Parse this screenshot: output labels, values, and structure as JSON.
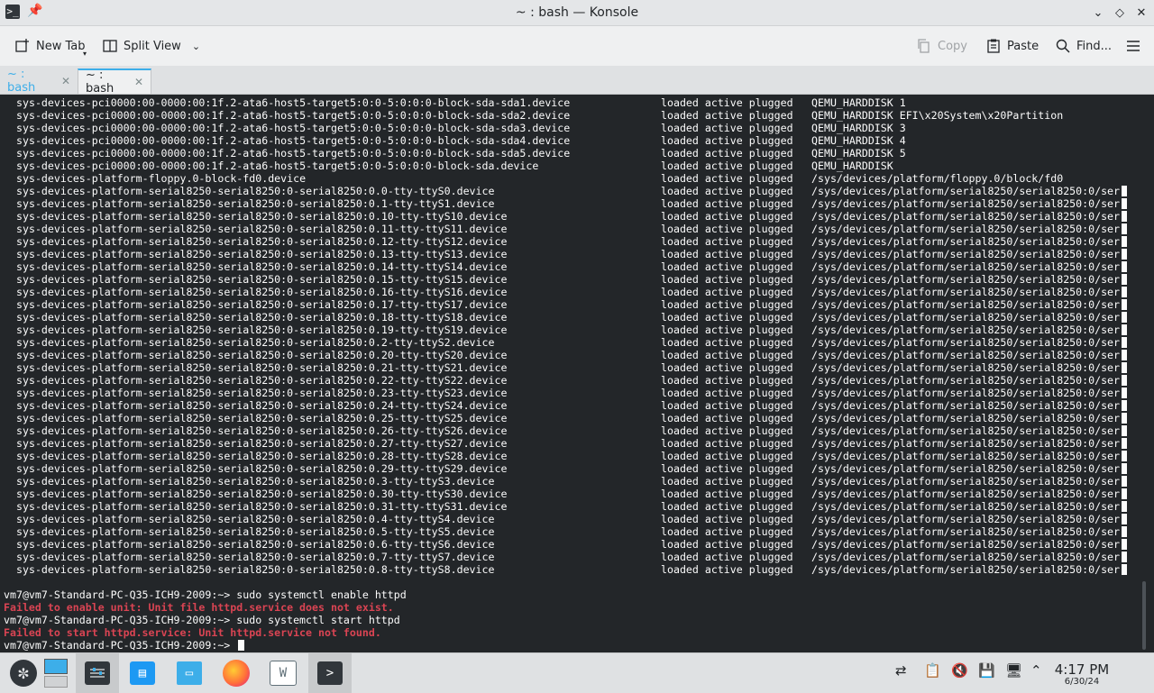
{
  "window": {
    "title": "~ : bash — Konsole",
    "app_icon": "terminal-icon",
    "controls": [
      "minimize",
      "maximize",
      "close"
    ]
  },
  "toolbar": {
    "new_tab": "New Tab",
    "split_view": "Split View",
    "copy": "Copy",
    "paste": "Paste",
    "find": "Find...",
    "menu_icon": "hamburger-menu-icon"
  },
  "tabs": [
    {
      "label": "~ : bash",
      "active": false
    },
    {
      "label": "~ : bash",
      "active": true
    }
  ],
  "terminal": {
    "rows": [
      {
        "unit": "sys-devices-pci0000:00-0000:00:1f.2-ata6-host5-target5:0:0-5:0:0:0-block-sda-sda1.device",
        "state": "loaded active plugged",
        "desc": "QEMU_HARDDISK 1",
        "truncated": false
      },
      {
        "unit": "sys-devices-pci0000:00-0000:00:1f.2-ata6-host5-target5:0:0-5:0:0:0-block-sda-sda2.device",
        "state": "loaded active plugged",
        "desc": "QEMU_HARDDISK EFI\\x20System\\x20Partition",
        "truncated": false
      },
      {
        "unit": "sys-devices-pci0000:00-0000:00:1f.2-ata6-host5-target5:0:0-5:0:0:0-block-sda-sda3.device",
        "state": "loaded active plugged",
        "desc": "QEMU_HARDDISK 3",
        "truncated": false
      },
      {
        "unit": "sys-devices-pci0000:00-0000:00:1f.2-ata6-host5-target5:0:0-5:0:0:0-block-sda-sda4.device",
        "state": "loaded active plugged",
        "desc": "QEMU_HARDDISK 4",
        "truncated": false
      },
      {
        "unit": "sys-devices-pci0000:00-0000:00:1f.2-ata6-host5-target5:0:0-5:0:0:0-block-sda-sda5.device",
        "state": "loaded active plugged",
        "desc": "QEMU_HARDDISK 5",
        "truncated": false
      },
      {
        "unit": "sys-devices-pci0000:00-0000:00:1f.2-ata6-host5-target5:0:0-5:0:0:0-block-sda.device",
        "state": "loaded active plugged",
        "desc": "QEMU_HARDDISK",
        "truncated": false
      },
      {
        "unit": "sys-devices-platform-floppy.0-block-fd0.device",
        "state": "loaded active plugged",
        "desc": "/sys/devices/platform/floppy.0/block/fd0",
        "truncated": false
      },
      {
        "unit": "sys-devices-platform-serial8250-serial8250:0-serial8250:0.0-tty-ttyS0.device",
        "state": "loaded active plugged",
        "desc": "/sys/devices/platform/serial8250/serial8250:0/ser",
        "truncated": true
      },
      {
        "unit": "sys-devices-platform-serial8250-serial8250:0-serial8250:0.1-tty-ttyS1.device",
        "state": "loaded active plugged",
        "desc": "/sys/devices/platform/serial8250/serial8250:0/ser",
        "truncated": true
      },
      {
        "unit": "sys-devices-platform-serial8250-serial8250:0-serial8250:0.10-tty-ttyS10.device",
        "state": "loaded active plugged",
        "desc": "/sys/devices/platform/serial8250/serial8250:0/ser",
        "truncated": true
      },
      {
        "unit": "sys-devices-platform-serial8250-serial8250:0-serial8250:0.11-tty-ttyS11.device",
        "state": "loaded active plugged",
        "desc": "/sys/devices/platform/serial8250/serial8250:0/ser",
        "truncated": true
      },
      {
        "unit": "sys-devices-platform-serial8250-serial8250:0-serial8250:0.12-tty-ttyS12.device",
        "state": "loaded active plugged",
        "desc": "/sys/devices/platform/serial8250/serial8250:0/ser",
        "truncated": true
      },
      {
        "unit": "sys-devices-platform-serial8250-serial8250:0-serial8250:0.13-tty-ttyS13.device",
        "state": "loaded active plugged",
        "desc": "/sys/devices/platform/serial8250/serial8250:0/ser",
        "truncated": true
      },
      {
        "unit": "sys-devices-platform-serial8250-serial8250:0-serial8250:0.14-tty-ttyS14.device",
        "state": "loaded active plugged",
        "desc": "/sys/devices/platform/serial8250/serial8250:0/ser",
        "truncated": true
      },
      {
        "unit": "sys-devices-platform-serial8250-serial8250:0-serial8250:0.15-tty-ttyS15.device",
        "state": "loaded active plugged",
        "desc": "/sys/devices/platform/serial8250/serial8250:0/ser",
        "truncated": true
      },
      {
        "unit": "sys-devices-platform-serial8250-serial8250:0-serial8250:0.16-tty-ttyS16.device",
        "state": "loaded active plugged",
        "desc": "/sys/devices/platform/serial8250/serial8250:0/ser",
        "truncated": true
      },
      {
        "unit": "sys-devices-platform-serial8250-serial8250:0-serial8250:0.17-tty-ttyS17.device",
        "state": "loaded active plugged",
        "desc": "/sys/devices/platform/serial8250/serial8250:0/ser",
        "truncated": true
      },
      {
        "unit": "sys-devices-platform-serial8250-serial8250:0-serial8250:0.18-tty-ttyS18.device",
        "state": "loaded active plugged",
        "desc": "/sys/devices/platform/serial8250/serial8250:0/ser",
        "truncated": true
      },
      {
        "unit": "sys-devices-platform-serial8250-serial8250:0-serial8250:0.19-tty-ttyS19.device",
        "state": "loaded active plugged",
        "desc": "/sys/devices/platform/serial8250/serial8250:0/ser",
        "truncated": true
      },
      {
        "unit": "sys-devices-platform-serial8250-serial8250:0-serial8250:0.2-tty-ttyS2.device",
        "state": "loaded active plugged",
        "desc": "/sys/devices/platform/serial8250/serial8250:0/ser",
        "truncated": true
      },
      {
        "unit": "sys-devices-platform-serial8250-serial8250:0-serial8250:0.20-tty-ttyS20.device",
        "state": "loaded active plugged",
        "desc": "/sys/devices/platform/serial8250/serial8250:0/ser",
        "truncated": true
      },
      {
        "unit": "sys-devices-platform-serial8250-serial8250:0-serial8250:0.21-tty-ttyS21.device",
        "state": "loaded active plugged",
        "desc": "/sys/devices/platform/serial8250/serial8250:0/ser",
        "truncated": true
      },
      {
        "unit": "sys-devices-platform-serial8250-serial8250:0-serial8250:0.22-tty-ttyS22.device",
        "state": "loaded active plugged",
        "desc": "/sys/devices/platform/serial8250/serial8250:0/ser",
        "truncated": true
      },
      {
        "unit": "sys-devices-platform-serial8250-serial8250:0-serial8250:0.23-tty-ttyS23.device",
        "state": "loaded active plugged",
        "desc": "/sys/devices/platform/serial8250/serial8250:0/ser",
        "truncated": true
      },
      {
        "unit": "sys-devices-platform-serial8250-serial8250:0-serial8250:0.24-tty-ttyS24.device",
        "state": "loaded active plugged",
        "desc": "/sys/devices/platform/serial8250/serial8250:0/ser",
        "truncated": true
      },
      {
        "unit": "sys-devices-platform-serial8250-serial8250:0-serial8250:0.25-tty-ttyS25.device",
        "state": "loaded active plugged",
        "desc": "/sys/devices/platform/serial8250/serial8250:0/ser",
        "truncated": true
      },
      {
        "unit": "sys-devices-platform-serial8250-serial8250:0-serial8250:0.26-tty-ttyS26.device",
        "state": "loaded active plugged",
        "desc": "/sys/devices/platform/serial8250/serial8250:0/ser",
        "truncated": true
      },
      {
        "unit": "sys-devices-platform-serial8250-serial8250:0-serial8250:0.27-tty-ttyS27.device",
        "state": "loaded active plugged",
        "desc": "/sys/devices/platform/serial8250/serial8250:0/ser",
        "truncated": true
      },
      {
        "unit": "sys-devices-platform-serial8250-serial8250:0-serial8250:0.28-tty-ttyS28.device",
        "state": "loaded active plugged",
        "desc": "/sys/devices/platform/serial8250/serial8250:0/ser",
        "truncated": true
      },
      {
        "unit": "sys-devices-platform-serial8250-serial8250:0-serial8250:0.29-tty-ttyS29.device",
        "state": "loaded active plugged",
        "desc": "/sys/devices/platform/serial8250/serial8250:0/ser",
        "truncated": true
      },
      {
        "unit": "sys-devices-platform-serial8250-serial8250:0-serial8250:0.3-tty-ttyS3.device",
        "state": "loaded active plugged",
        "desc": "/sys/devices/platform/serial8250/serial8250:0/ser",
        "truncated": true
      },
      {
        "unit": "sys-devices-platform-serial8250-serial8250:0-serial8250:0.30-tty-ttyS30.device",
        "state": "loaded active plugged",
        "desc": "/sys/devices/platform/serial8250/serial8250:0/ser",
        "truncated": true
      },
      {
        "unit": "sys-devices-platform-serial8250-serial8250:0-serial8250:0.31-tty-ttyS31.device",
        "state": "loaded active plugged",
        "desc": "/sys/devices/platform/serial8250/serial8250:0/ser",
        "truncated": true
      },
      {
        "unit": "sys-devices-platform-serial8250-serial8250:0-serial8250:0.4-tty-ttyS4.device",
        "state": "loaded active plugged",
        "desc": "/sys/devices/platform/serial8250/serial8250:0/ser",
        "truncated": true
      },
      {
        "unit": "sys-devices-platform-serial8250-serial8250:0-serial8250:0.5-tty-ttyS5.device",
        "state": "loaded active plugged",
        "desc": "/sys/devices/platform/serial8250/serial8250:0/ser",
        "truncated": true
      },
      {
        "unit": "sys-devices-platform-serial8250-serial8250:0-serial8250:0.6-tty-ttyS6.device",
        "state": "loaded active plugged",
        "desc": "/sys/devices/platform/serial8250/serial8250:0/ser",
        "truncated": true
      },
      {
        "unit": "sys-devices-platform-serial8250-serial8250:0-serial8250:0.7-tty-ttyS7.device",
        "state": "loaded active plugged",
        "desc": "/sys/devices/platform/serial8250/serial8250:0/ser",
        "truncated": true
      },
      {
        "unit": "sys-devices-platform-serial8250-serial8250:0-serial8250:0.8-tty-ttyS8.device",
        "state": "loaded active plugged",
        "desc": "/sys/devices/platform/serial8250/serial8250:0/ser",
        "truncated": true
      }
    ],
    "shell": [
      {
        "text": "vm7@vm7-Standard-PC-Q35-ICH9-2009:~> sudo systemctl enable httpd",
        "error": false
      },
      {
        "text": "Failed to enable unit: Unit file httpd.service does not exist.",
        "error": true
      },
      {
        "text": "vm7@vm7-Standard-PC-Q35-ICH9-2009:~> sudo systemctl start httpd",
        "error": false
      },
      {
        "text": "Failed to start httpd.service: Unit httpd.service not found.",
        "error": true
      },
      {
        "text": "vm7@vm7-Standard-PC-Q35-ICH9-2009:~> ",
        "error": false,
        "cursor": true
      }
    ],
    "colors": {
      "background": "#232629",
      "foreground": "#fcfcfc",
      "error": "#da4453"
    }
  },
  "taskbar": {
    "items": [
      {
        "name": "application-launcher-icon",
        "active": false
      },
      {
        "name": "desktop-pager-icon",
        "active": false
      },
      {
        "name": "system-settings-icon",
        "active": true
      },
      {
        "name": "discover-store-icon",
        "active": false
      },
      {
        "name": "file-manager-icon",
        "active": false
      },
      {
        "name": "firefox-icon",
        "active": false
      },
      {
        "name": "vmware-icon",
        "active": false
      },
      {
        "name": "konsole-icon",
        "active": true
      }
    ],
    "tray": [
      "network-icon",
      "clipboard-icon",
      "volume-muted-icon",
      "storage-icon",
      "display-icon",
      "expand-tray-icon"
    ],
    "clock": {
      "time": "4:17 PM",
      "date": "6/30/24"
    }
  }
}
